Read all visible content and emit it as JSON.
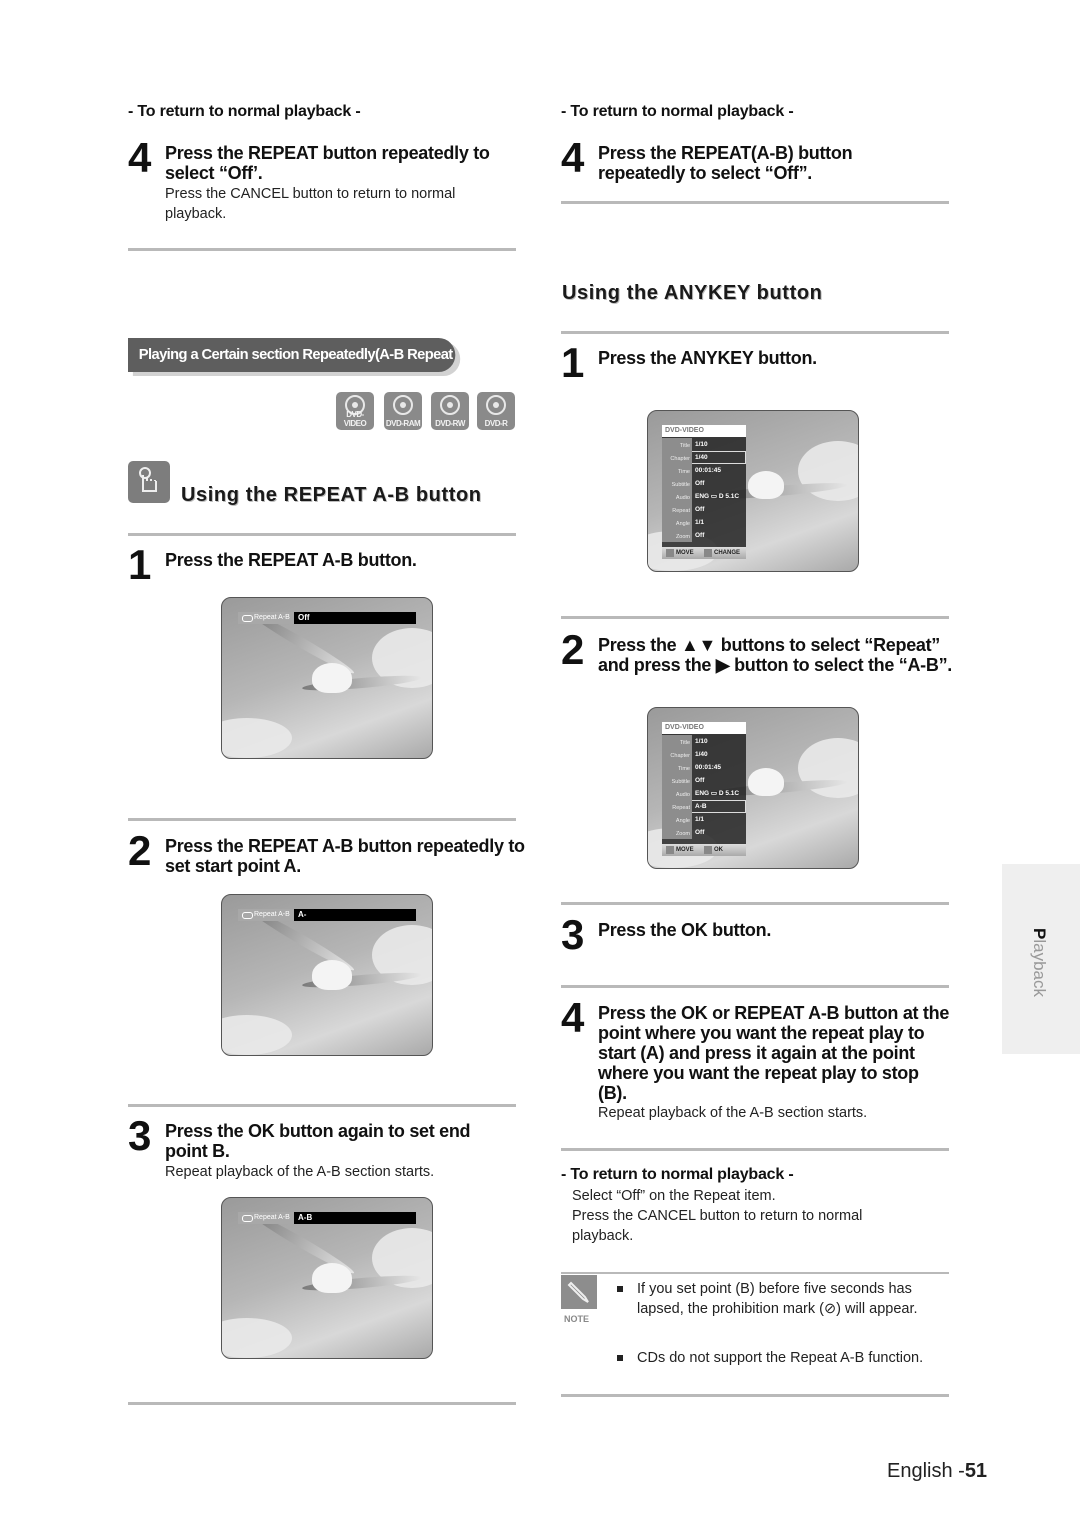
{
  "left": {
    "return_heading": "- To return to normal playback -",
    "step4": {
      "num": "4",
      "title": "Press the REPEAT button repeatedly to select “Off’.",
      "desc": "Press the CANCEL button to return to normal playback."
    },
    "banner": "Playing a Certain section Repeatedly(A-B Repeat Playback)",
    "discs": [
      "DVD-VIDEO",
      "DVD-RAM",
      "DVD-RW",
      "DVD-R"
    ],
    "section_title": "Using the REPEAT A-B button",
    "step1": {
      "num": "1",
      "title": "Press the REPEAT A-B button."
    },
    "screen1": {
      "tag": "Repeat A-B",
      "value": "Off"
    },
    "step2": {
      "num": "2",
      "title": "Press the REPEAT A-B button repeatedly to set start point A."
    },
    "screen2": {
      "tag": "Repeat A-B",
      "value": "A-"
    },
    "step3": {
      "num": "3",
      "title": "Press the OK button again to set end point B.",
      "desc": "Repeat playback of the A-B section starts."
    },
    "screen3": {
      "tag": "Repeat A-B",
      "value": "A-B"
    }
  },
  "right": {
    "return_heading": "- To return to normal playback -",
    "step4_top": {
      "num": "4",
      "title": "Press the REPEAT(A-B) button repeatedly to select “Off”."
    },
    "section_title": "Using the ANYKEY button",
    "step1": {
      "num": "1",
      "title": "Press the ANYKEY button."
    },
    "menu1": {
      "header": "DVD-VIDEO",
      "rows": [
        {
          "key": "Title",
          "value": "1/10"
        },
        {
          "key": "Chapter",
          "value": "1/40"
        },
        {
          "key": "Time",
          "value": "00:01:45"
        },
        {
          "key": "Subtitle",
          "value": "Off"
        },
        {
          "key": "Audio",
          "value": "ENG ▭ D 5.1C"
        },
        {
          "key": "Repeat",
          "value": "Off"
        },
        {
          "key": "Angle",
          "value": "1/1"
        },
        {
          "key": "Zoom",
          "value": "Off"
        }
      ],
      "footer_left": "MOVE",
      "footer_right": "CHANGE"
    },
    "step2": {
      "num": "2",
      "title_line1": "Press the ▲▼ buttons to select “Repeat”",
      "title_line2": "and press the ▶ button to select the “A-B”."
    },
    "menu2": {
      "header": "DVD-VIDEO",
      "rows": [
        {
          "key": "Title",
          "value": "1/10"
        },
        {
          "key": "Chapter",
          "value": "1/40"
        },
        {
          "key": "Time",
          "value": "00:01:45"
        },
        {
          "key": "Subtitle",
          "value": "Off"
        },
        {
          "key": "Audio",
          "value": "ENG ▭ D 5.1C"
        },
        {
          "key": "Repeat",
          "value": "A-B"
        },
        {
          "key": "Angle",
          "value": "1/1"
        },
        {
          "key": "Zoom",
          "value": "Off"
        }
      ],
      "footer_left": "MOVE",
      "footer_right": "OK"
    },
    "step3": {
      "num": "3",
      "title": "Press the OK button."
    },
    "step4": {
      "num": "4",
      "title": "Press the OK or REPEAT A-B button at the point where you want the repeat play to start (A) and press it again at the point where you want the repeat play to stop (B).",
      "desc": "Repeat playback of the A-B section starts."
    },
    "return2_heading": "- To return to normal playback -",
    "return2_lines": [
      "Select “Off” on the Repeat item.",
      "Press the CANCEL button to return to normal playback."
    ],
    "note": {
      "label": "NOTE",
      "items": [
        "If you set point (B) before five seconds has lapsed, the prohibition mark (⊘) will appear.",
        "CDs do not support the Repeat A-B function."
      ]
    }
  },
  "side_tab": {
    "first": "P",
    "rest": "layback"
  },
  "footer": {
    "lang": "English -",
    "page": "51"
  }
}
